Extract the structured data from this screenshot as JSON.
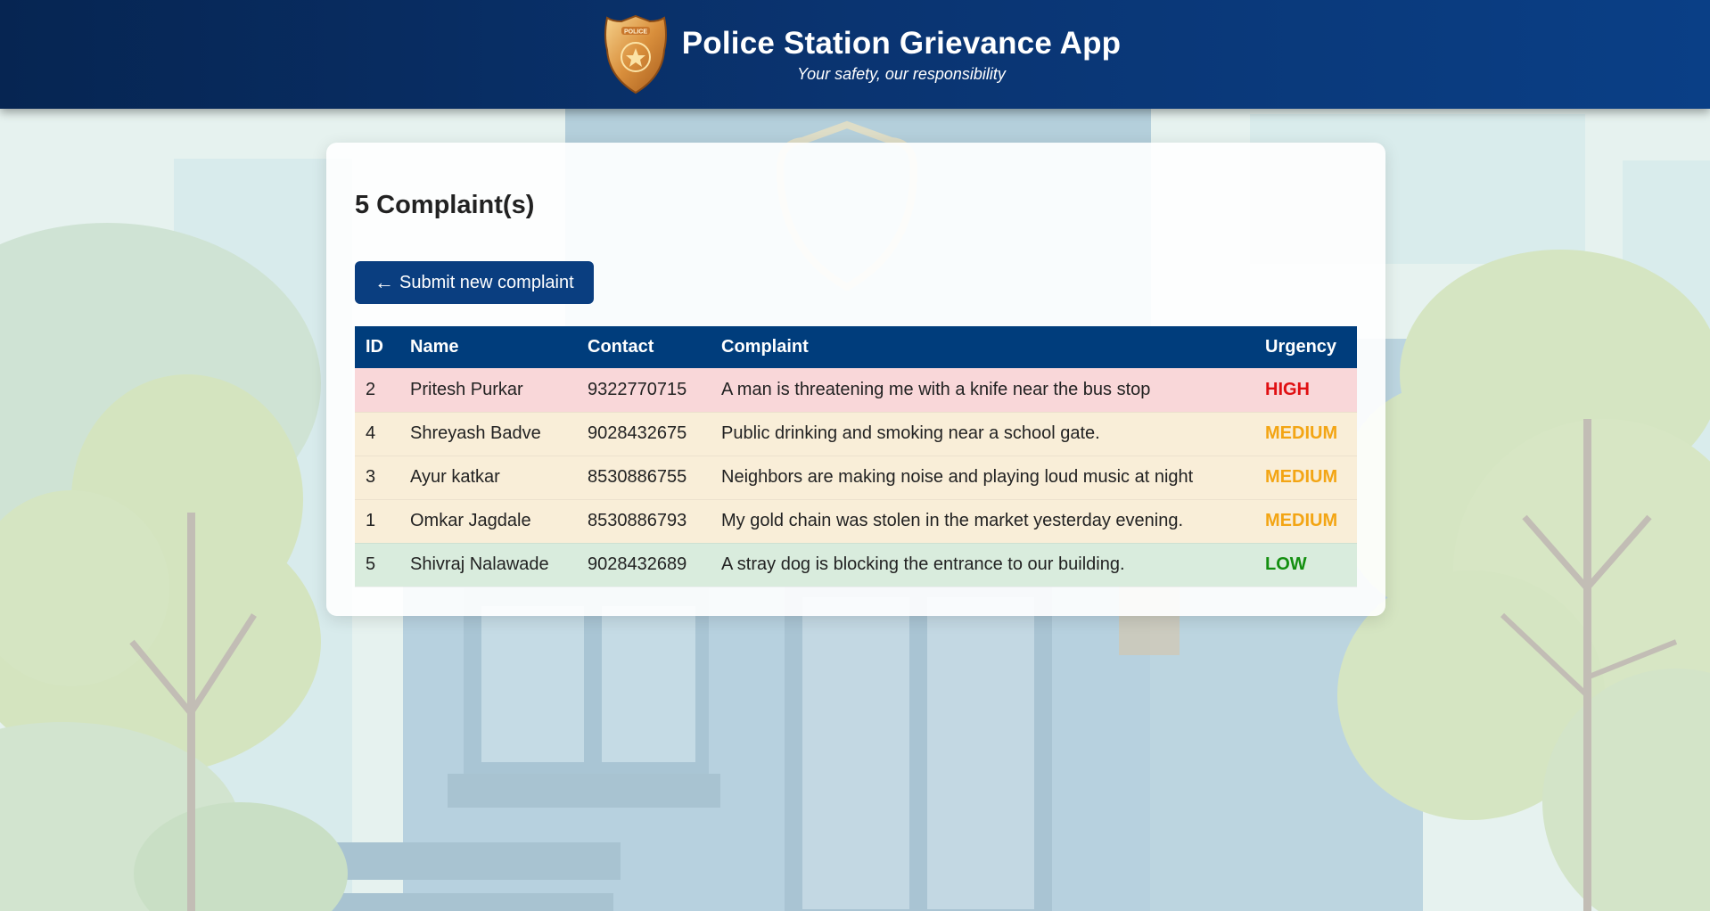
{
  "header": {
    "title": "Police Station Grievance App",
    "tagline": "Your safety, our responsibility",
    "badge_text": "POLICE"
  },
  "main": {
    "count": "5",
    "count_suffix": "Complaint(s)",
    "submit_arrow": "←",
    "submit_label": "Submit new complaint"
  },
  "table": {
    "headers": {
      "id": "ID",
      "name": "Name",
      "contact": "Contact",
      "complaint": "Complaint",
      "urgency": "Urgency"
    },
    "rows": [
      {
        "id": "2",
        "name": "Pritesh Purkar",
        "contact": "9322770715",
        "complaint": "A man is threatening me with a knife near the bus stop",
        "urgency": "HIGH"
      },
      {
        "id": "4",
        "name": "Shreyash Badve",
        "contact": "9028432675",
        "complaint": "Public drinking and smoking near a school gate.",
        "urgency": "MEDIUM"
      },
      {
        "id": "3",
        "name": "Ayur katkar",
        "contact": "8530886755",
        "complaint": "Neighbors are making noise and playing loud music at night",
        "urgency": "MEDIUM"
      },
      {
        "id": "1",
        "name": "Omkar Jagdale",
        "contact": "8530886793",
        "complaint": "My gold chain was stolen in the market yesterday evening.",
        "urgency": "MEDIUM"
      },
      {
        "id": "5",
        "name": "Shivraj Nalawade",
        "contact": "9028432689",
        "complaint": "A stray dog is blocking the entrance to our building.",
        "urgency": "LOW"
      }
    ]
  },
  "colors": {
    "header_bg": "#0a3471",
    "accent": "#0a3e80",
    "high": "#e00f12",
    "medium": "#f3a514",
    "low": "#148f10",
    "high_row": "#f9d7d9",
    "medium_row": "#f9eed8",
    "low_row": "#d9ecdd"
  },
  "icons": {
    "badge": "police-badge-icon",
    "arrow": "left-arrow-icon"
  }
}
